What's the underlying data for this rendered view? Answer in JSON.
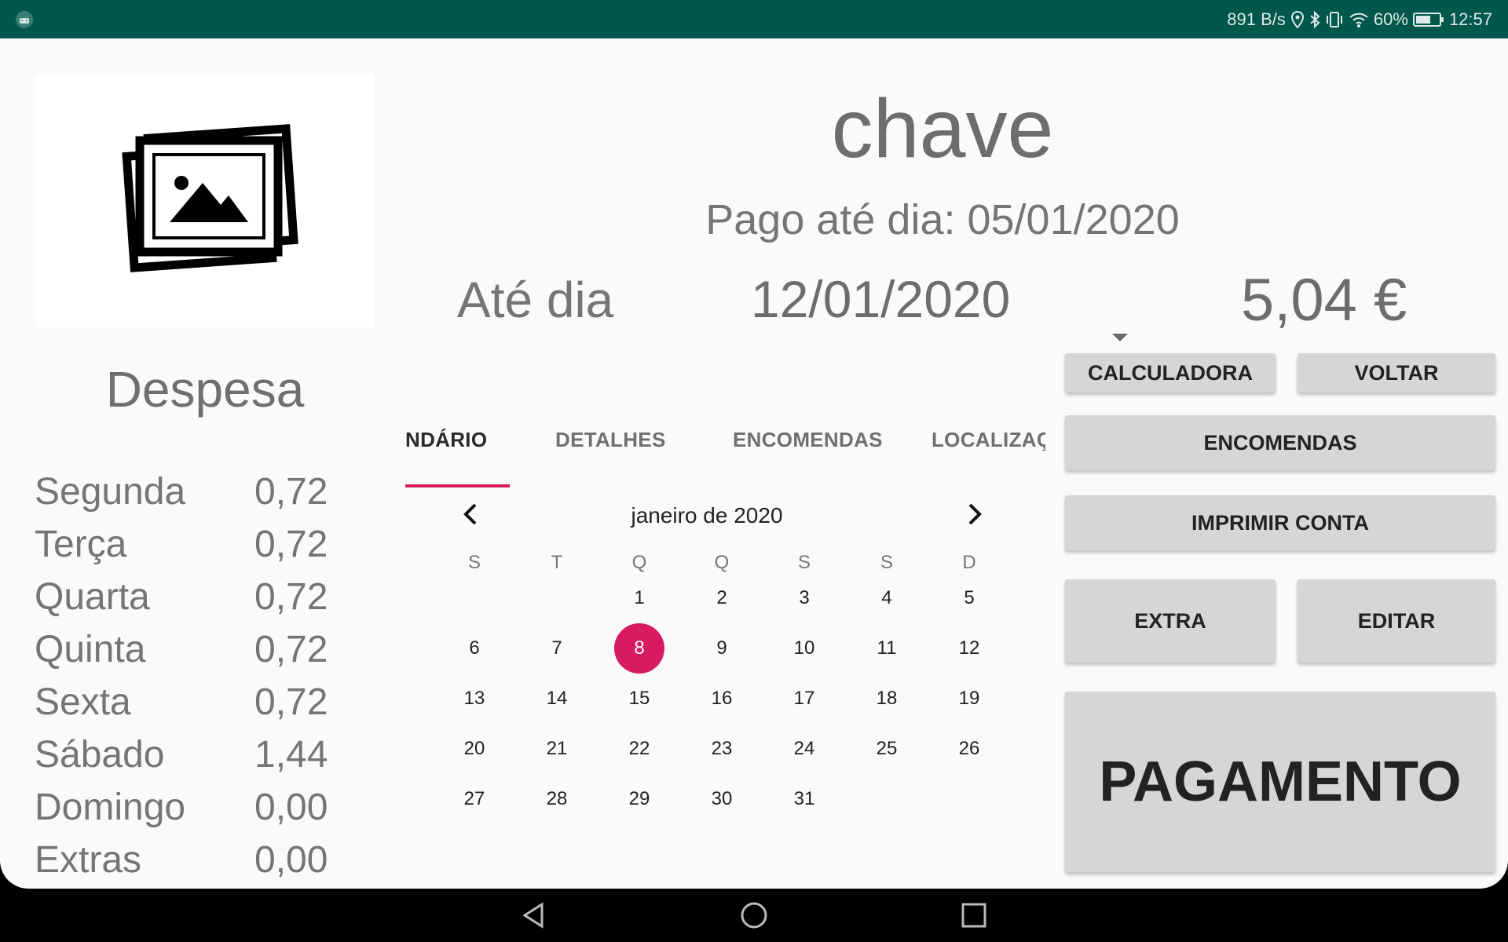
{
  "status": {
    "net_speed": "891 B/s",
    "battery": "60%",
    "time": "12:57"
  },
  "header": {
    "title": "chave",
    "paid_until": "Pago até dia: 05/01/2020",
    "until_label": "Até dia",
    "until_date": "12/01/2020",
    "amount": "5,04 €"
  },
  "expenses": {
    "title": "Despesa",
    "rows": [
      {
        "day": "Segunda",
        "value": "0,72"
      },
      {
        "day": "Terça",
        "value": "0,72"
      },
      {
        "day": "Quarta",
        "value": "0,72"
      },
      {
        "day": "Quinta",
        "value": "0,72"
      },
      {
        "day": "Sexta",
        "value": "0,72"
      },
      {
        "day": "Sábado",
        "value": "1,44"
      },
      {
        "day": "Domingo",
        "value": "0,00"
      },
      {
        "day": "Extras",
        "value": "0,00"
      }
    ]
  },
  "tabs": [
    {
      "label": "NDÁRIO"
    },
    {
      "label": "DETALHES"
    },
    {
      "label": "ENCOMENDAS"
    },
    {
      "label": "LOCALIZAÇ"
    }
  ],
  "calendar": {
    "month": "janeiro de 2020",
    "weekdays": [
      "S",
      "T",
      "Q",
      "Q",
      "S",
      "S",
      "D"
    ],
    "weeks": [
      [
        "",
        "",
        "1",
        "2",
        "3",
        "4",
        "5"
      ],
      [
        "6",
        "7",
        "8",
        "9",
        "10",
        "11",
        "12"
      ],
      [
        "13",
        "14",
        "15",
        "16",
        "17",
        "18",
        "19"
      ],
      [
        "20",
        "21",
        "22",
        "23",
        "24",
        "25",
        "26"
      ],
      [
        "27",
        "28",
        "29",
        "30",
        "31",
        "",
        ""
      ]
    ],
    "selected": "8"
  },
  "buttons": {
    "calculator": "CALCULADORA",
    "back": "VOLTAR",
    "orders": "ENCOMENDAS",
    "print": "IMPRIMIR CONTA",
    "extra": "EXTRA",
    "edit": "EDITAR",
    "payment": "PAGAMENTO"
  },
  "colors": {
    "status_bar": "#00574b",
    "accent": "#d81b60",
    "button": "#d6d6d6"
  }
}
